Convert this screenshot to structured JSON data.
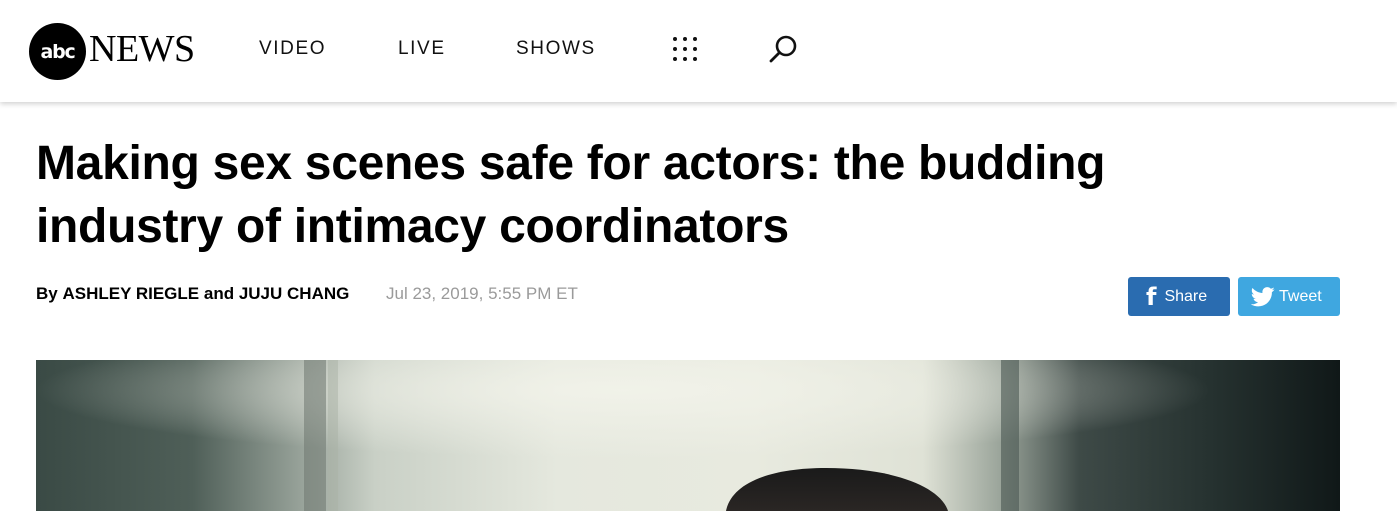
{
  "header": {
    "logo": {
      "circle_text": "abc",
      "wordmark": "NEWS"
    },
    "nav": [
      {
        "label": "VIDEO"
      },
      {
        "label": "LIVE"
      },
      {
        "label": "SHOWS"
      }
    ],
    "menu_icon": "grid-dots-icon",
    "search_icon": "search-icon"
  },
  "article": {
    "headline": "Making sex scenes safe for actors: the budding industry of intimacy coordinators",
    "byline_prefix": "By",
    "author1": "ASHLEY RIEGLE",
    "byline_conj": "and",
    "author2": "JUJU CHANG",
    "date": "Jul 23, 2019, 5:55 PM ET"
  },
  "share": {
    "facebook": {
      "label": "Share",
      "icon": "facebook-icon",
      "color": "#2a6cb0"
    },
    "twitter": {
      "label": "Tweet",
      "icon": "twitter-icon",
      "color": "#3fa7e0"
    }
  }
}
